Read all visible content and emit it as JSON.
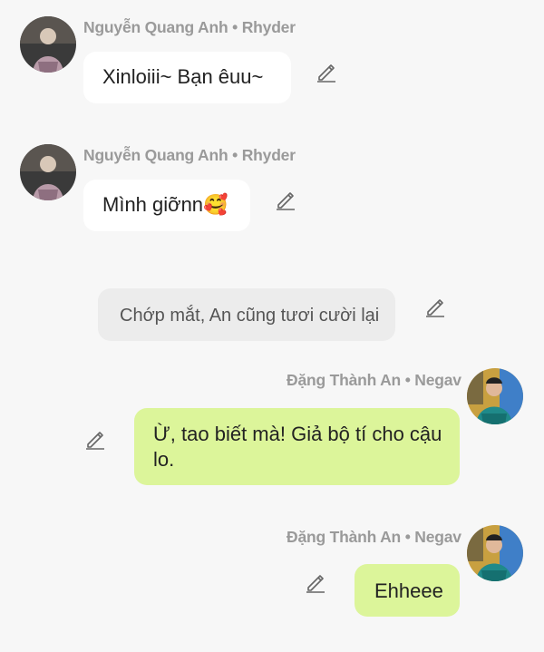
{
  "messages": [
    {
      "sender": "Nguyễn Quang Anh • Rhyder",
      "text": "Xinloiii~ Bạn êuu~"
    },
    {
      "sender": "Nguyễn Quang Anh • Rhyder",
      "text": "Mình giỡnn🥰"
    },
    {
      "narration": "Chớp mắt, An cũng tươi cười lại"
    },
    {
      "sender": "Đặng Thành An • Negav",
      "text": "Ừ, tao biết mà! Giả bộ tí cho cậu lo."
    },
    {
      "sender": "Đặng Thành An • Negav",
      "text": "Ehheee"
    }
  ],
  "icons": {
    "edit": "pencil-icon",
    "avatar_left": "avatar-rhyder",
    "avatar_right": "avatar-negav"
  },
  "colors": {
    "background": "#f7f7f7",
    "bubble_left": "#ffffff",
    "bubble_right": "#dcf59a",
    "narration_bg": "#ececec",
    "sender": "#9a9a9a"
  }
}
